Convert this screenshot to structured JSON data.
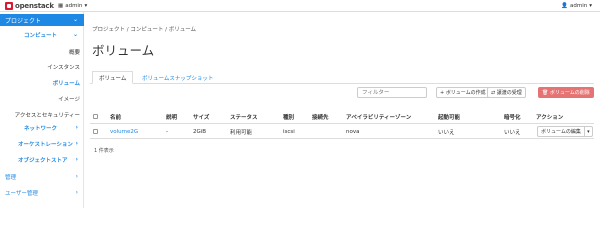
{
  "header": {
    "logo_text": "openstack",
    "project_selector": "admin",
    "user_menu": "admin"
  },
  "sidebar": {
    "project": "プロジェクト",
    "compute": "コンピュート",
    "items": [
      "概要",
      "インスタンス",
      "ボリューム",
      "イメージ",
      "アクセスとセキュリティー"
    ],
    "network": "ネットワーク",
    "orchestration": "オーケストレーション",
    "object_store": "オブジェクトストア",
    "admin": "管理",
    "identity": "ユーザー管理"
  },
  "breadcrumb": "プロジェクト / コンピュート / ボリューム",
  "title": "ボリューム",
  "tabs": [
    "ボリューム",
    "ボリュームスナップショット"
  ],
  "toolbar": {
    "filter_placeholder": "フィルター",
    "create": "+ ボリュームの作成",
    "accept_transfer": "⇄ 譲渡の受理",
    "delete": "🗑 ボリュームの削除"
  },
  "table": {
    "headers": [
      "名前",
      "説明",
      "サイズ",
      "ステータス",
      "種別",
      "接続先",
      "アベイラビリティーゾーン",
      "起動可能",
      "暗号化",
      "アクション"
    ],
    "rows": [
      {
        "name": "volume2G",
        "description": "-",
        "size": "2GiB",
        "status": "利用可能",
        "type": "iscsi",
        "attached_to": "",
        "zone": "nova",
        "bootable": "いいえ",
        "encrypted": "いいえ",
        "action": "ボリュームの編集"
      }
    ]
  },
  "footer_count": "1 件表示",
  "colors": {
    "accent": "#1e88e5",
    "danger": "#e57373",
    "brand": "#da1a32"
  }
}
